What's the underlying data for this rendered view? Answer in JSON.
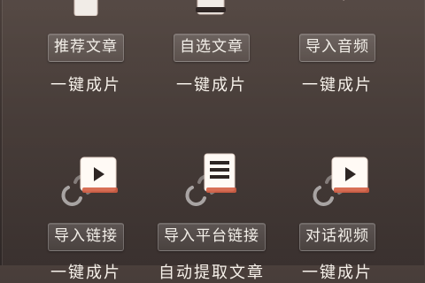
{
  "tiles": [
    {
      "label": "推荐文章",
      "subtitle": "一键成片",
      "icon": "document-icon"
    },
    {
      "label": "自选文章",
      "subtitle": "一键成片",
      "icon": "document-stack-icon"
    },
    {
      "label": "导入音频",
      "subtitle": "一键成片",
      "icon": "speaker-icon"
    },
    {
      "label": "导入链接",
      "subtitle": "一键成片",
      "icon": "link-video-icon"
    },
    {
      "label": "导入平台链接",
      "subtitle": "自动提取文章",
      "icon": "link-document-icon"
    },
    {
      "label": "对话视频",
      "subtitle": "一键成片",
      "icon": "link-video-icon"
    }
  ],
  "colors": {
    "icon_fill": "#fffaf5",
    "accent": "#e26b4d",
    "text": "#f6f1ea"
  }
}
